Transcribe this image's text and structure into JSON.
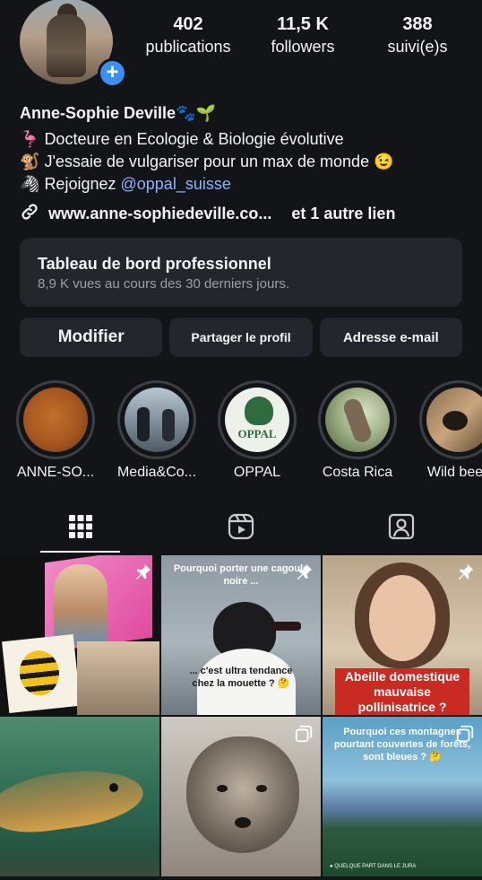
{
  "profile": {
    "stats": [
      {
        "value": "402",
        "label": "publications"
      },
      {
        "value": "11,5 K",
        "label": "followers"
      },
      {
        "value": "388",
        "label": "suivi(e)s"
      }
    ],
    "name": "Anne-Sophie Deville🐾🌱",
    "bio": [
      {
        "emoji": "🦩",
        "text": "Docteure en Ecologie & Biologie évolutive"
      },
      {
        "emoji": "🐒",
        "text": "J'essaie de vulgariser pour un max de monde 😉"
      },
      {
        "emoji": "🦓",
        "text": "Rejoignez ",
        "mention": "@oppal_suisse"
      }
    ],
    "link": "www.anne-sophiedeville.co...",
    "link_more": "et 1 autre lien"
  },
  "dashboard": {
    "title": "Tableau de bord professionnel",
    "subtitle": "8,9 K vues au cours des 30 derniers jours."
  },
  "buttons": {
    "edit": "Modifier",
    "share": "Partager le profil",
    "email": "Adresse e-mail"
  },
  "highlights": [
    {
      "label": "ANNE-SO..."
    },
    {
      "label": "Media&Co..."
    },
    {
      "label": "OPPAL"
    },
    {
      "label": "Costa Rica"
    },
    {
      "label": "Wild bees"
    }
  ],
  "highlight_texts": {
    "oppal_logo": "OPPAL"
  },
  "grid": {
    "post2_top": "Pourquoi porter une cagoule noire ...",
    "post2_bottom": "... c'est ultra tendance chez la mouette ? 🤔",
    "post3_text": "Abeille domestique mauvaise pollinisatrice ?",
    "post6_text": "Pourquoi ces montagnes pourtant couvertes de forêts, sont bleues ? 🤔",
    "post6_location": "QUELQUE PART DANS LE JURA"
  },
  "colors": {
    "background": "#121418",
    "card": "#23262c",
    "accent_blue": "#3b8ff2",
    "mention": "#8ab4ff"
  },
  "icons": {
    "grid_tab": "grid-icon",
    "reels_tab": "reels-icon",
    "tagged_tab": "tagged-icon",
    "link": "link-icon",
    "pin": "pin-icon"
  }
}
